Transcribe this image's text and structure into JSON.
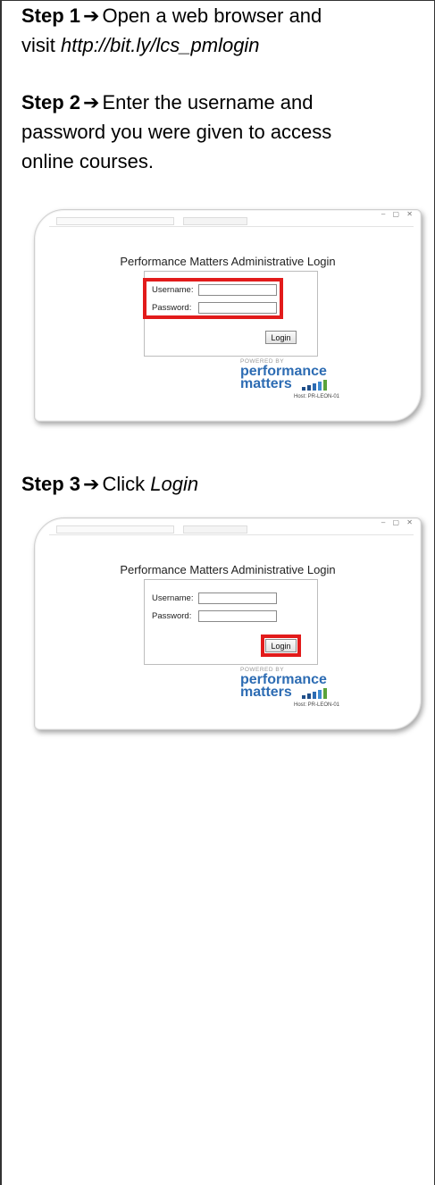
{
  "steps": {
    "step1": {
      "label": "Step 1",
      "arrow": "➔",
      "text_a": "Open a web browser and",
      "text_b": "visit ",
      "link": "http://bit.ly/lcs_pmlogin"
    },
    "step2": {
      "label": "Step 2",
      "arrow": "➔",
      "line1": "Enter the username and",
      "line2": "password you were given to access",
      "line3": "online courses."
    },
    "step3": {
      "label": "Step 3",
      "arrow": "➔",
      "text": "Click ",
      "emph": "Login"
    }
  },
  "login_screen": {
    "title": "Performance Matters Administrative Login",
    "username_label": "Username:",
    "password_label": "Password:",
    "button": "Login",
    "powered_by": "POWERED BY",
    "brand_line1": "performance",
    "brand_line2": "matters",
    "host": "Host: PR-LEON-01",
    "window_buttons": "– ▢ ✕",
    "brand_color": "#2d6cb3",
    "bars_color": "#1f4f8a",
    "highlight_color": "#e21b1b"
  }
}
